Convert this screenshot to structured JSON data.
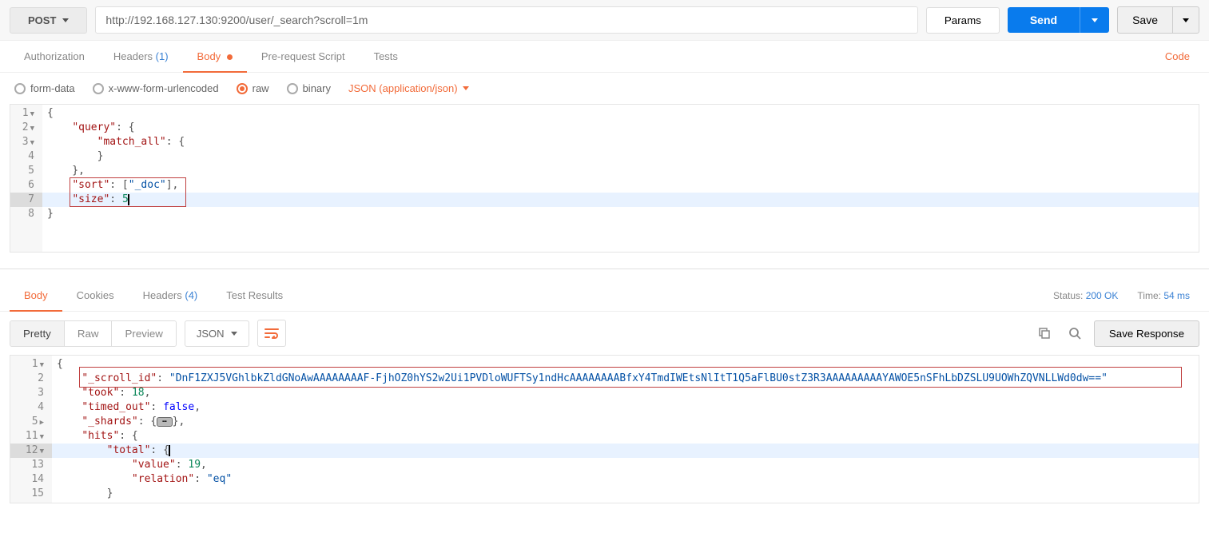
{
  "request": {
    "method": "POST",
    "url": "http://192.168.127.130:9200/user/_search?scroll=1m",
    "params_label": "Params",
    "send_label": "Send",
    "save_label": "Save"
  },
  "request_tabs": {
    "authorization": "Authorization",
    "headers": "Headers",
    "headers_count": "(1)",
    "body": "Body",
    "pre_request": "Pre-request Script",
    "tests": "Tests",
    "code": "Code"
  },
  "body_options": {
    "form_data": "form-data",
    "urlencoded": "x-www-form-urlencoded",
    "raw": "raw",
    "binary": "binary",
    "content_type": "JSON (application/json)"
  },
  "request_body_lines": [
    {
      "n": "1",
      "fold": true
    },
    {
      "n": "2",
      "fold": true
    },
    {
      "n": "3",
      "fold": true
    },
    {
      "n": "4"
    },
    {
      "n": "5"
    },
    {
      "n": "6"
    },
    {
      "n": "7"
    },
    {
      "n": "8"
    }
  ],
  "request_body": {
    "l1_open": "{",
    "l2_key": "\"query\"",
    "l2_rest": ": {",
    "l3_key": "\"match_all\"",
    "l3_rest": ": {",
    "l4": "        }",
    "l5": "    },",
    "l6_key": "\"sort\"",
    "l6_mid": ": [",
    "l6_val": "\"_doc\"",
    "l6_end": "],",
    "l7_key": "\"size\"",
    "l7_mid": ": ",
    "l7_val": "5",
    "l8": "}"
  },
  "response_tabs": {
    "body": "Body",
    "cookies": "Cookies",
    "headers": "Headers",
    "headers_count": "(4)",
    "test_results": "Test Results"
  },
  "response_meta": {
    "status_label": "Status:",
    "status_value": "200 OK",
    "time_label": "Time:",
    "time_value": "54 ms"
  },
  "response_toolbar": {
    "pretty": "Pretty",
    "raw": "Raw",
    "preview": "Preview",
    "format": "JSON",
    "save_response": "Save Response"
  },
  "response_body_lines": [
    {
      "n": "1",
      "fold": true
    },
    {
      "n": "2"
    },
    {
      "n": "3"
    },
    {
      "n": "4"
    },
    {
      "n": "5",
      "fold": true
    },
    {
      "n": "11",
      "fold": true
    },
    {
      "n": "12",
      "fold": true
    },
    {
      "n": "13"
    },
    {
      "n": "14"
    },
    {
      "n": "15"
    }
  ],
  "response_body": {
    "l1": "{",
    "l2_key": "\"_scroll_id\"",
    "l2_mid": ": ",
    "l2_val": "\"DnF1ZXJ5VGhlbkZldGNoAwAAAAAAAAF-FjhOZ0hYS2w2Ui1PVDloWUFTSy1ndHcAAAAAAAABfxY4TmdIWEtsNlItT1Q5aFlBU0stZ3R3AAAAAAAAAYAWOE5nSFhLbDZSLU9UOWhZQVNLLWd0dw==\"",
    "l3_key": "\"took\"",
    "l3_mid": ": ",
    "l3_val": "18",
    "l3_end": ",",
    "l4_key": "\"timed_out\"",
    "l4_mid": ": ",
    "l4_val": "false",
    "l4_end": ",",
    "l5_key": "\"_shards\"",
    "l5_mid": ": {",
    "l5_end": "},",
    "l11_key": "\"hits\"",
    "l11_rest": ": {",
    "l12_key": "\"total\"",
    "l12_rest": ": {",
    "l13_key": "\"value\"",
    "l13_mid": ": ",
    "l13_val": "19",
    "l13_end": ",",
    "l14_key": "\"relation\"",
    "l14_mid": ": ",
    "l14_val": "\"eq\"",
    "l15": "        }"
  }
}
